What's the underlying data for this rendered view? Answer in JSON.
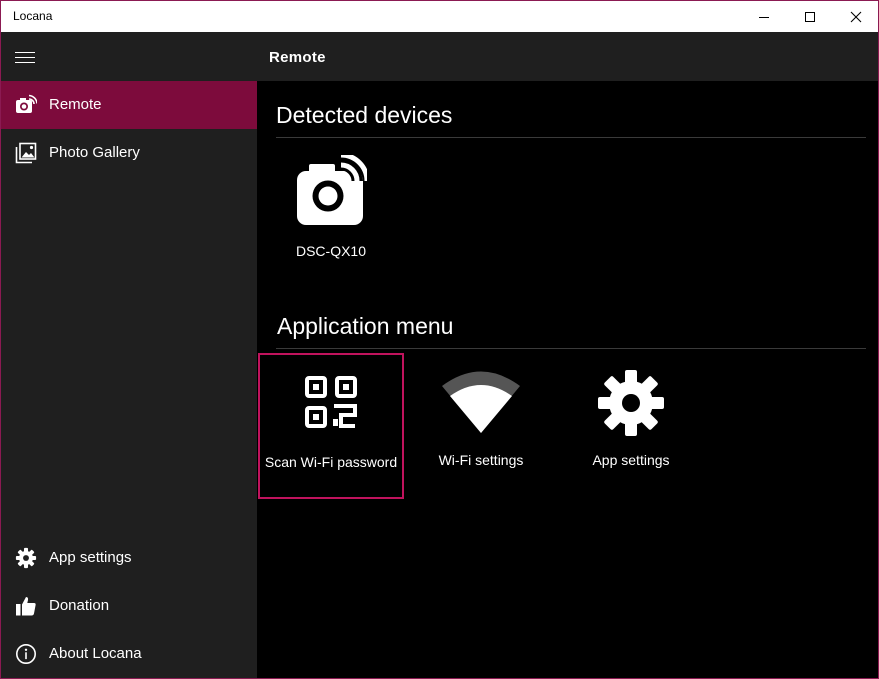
{
  "window": {
    "title": "Locana",
    "accent": "#7d0b3c",
    "focus_color": "#c0135d"
  },
  "sidebar": {
    "top_items": [
      {
        "label": "Remote",
        "icon": "camera-wifi-icon",
        "active": true
      },
      {
        "label": "Photo Gallery",
        "icon": "photo-gallery-icon",
        "active": false
      }
    ],
    "bottom_items": [
      {
        "label": "App settings",
        "icon": "gear-icon"
      },
      {
        "label": "Donation",
        "icon": "thumbs-up-icon"
      },
      {
        "label": "About Locana",
        "icon": "info-icon"
      }
    ]
  },
  "header": {
    "title": "Remote"
  },
  "main": {
    "detected_devices": {
      "title": "Detected devices",
      "devices": [
        {
          "label": "DSC-QX10",
          "icon": "camera-wifi-icon"
        }
      ]
    },
    "application_menu": {
      "title": "Application menu",
      "items": [
        {
          "label": "Scan Wi-Fi password",
          "icon": "qr-code-icon",
          "focused": true
        },
        {
          "label": "Wi-Fi settings",
          "icon": "wifi-icon",
          "focused": false
        },
        {
          "label": "App settings",
          "icon": "gear-icon",
          "focused": false
        }
      ]
    }
  }
}
